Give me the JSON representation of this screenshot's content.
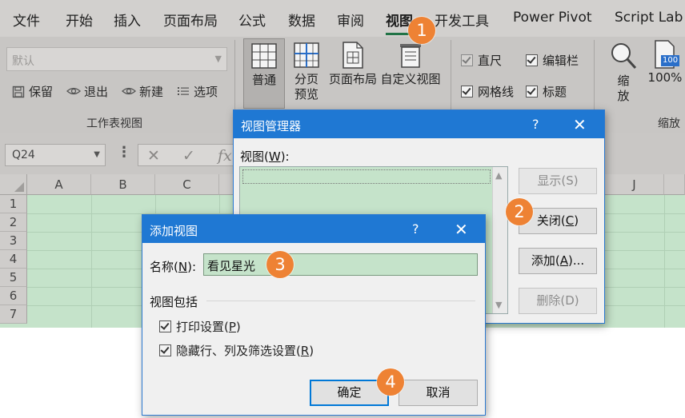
{
  "ribbon_tabs": [
    "文件",
    "开始",
    "插入",
    "页面布局",
    "公式",
    "数据",
    "审阅",
    "视图",
    "开发工具",
    "Power Pivot",
    "Script Lab"
  ],
  "active_tab": "视图",
  "workbook_views_group": {
    "sheet_view_combo": "默认",
    "keep_label": "保留",
    "exit_label": "退出",
    "new_label": "新建",
    "options_label": "选项",
    "group_label": "工作表视图"
  },
  "view_buttons": {
    "normal": "普通",
    "page_break_line1": "分页",
    "page_break_line2": "预览",
    "page_layout": "页面布局",
    "custom_views": "自定义视图"
  },
  "show_group": {
    "ruler": "直尺",
    "formula_bar": "编辑栏",
    "gridlines": "网格线",
    "headings": "标题"
  },
  "zoom_group": {
    "zoom_line1": "缩",
    "zoom_line2": "放",
    "zoom_100": "100%",
    "zoom_100_icon_text": "100",
    "group_label": "缩放"
  },
  "formula_bar": {
    "name_box": "Q24",
    "fx": "fx"
  },
  "grid": {
    "columns": [
      "A",
      "B",
      "C",
      "J"
    ],
    "rows": [
      "1",
      "2",
      "3",
      "4",
      "5",
      "6",
      "7"
    ]
  },
  "view_manager_dialog": {
    "title": "视图管理器",
    "help": "?",
    "views_label_prefix": "视图(",
    "views_label_key": "W",
    "views_label_suffix": "):",
    "show_button": "显示(S)",
    "close_button_prefix": "关闭(",
    "close_button_key": "C",
    "close_button_suffix": ")",
    "add_button_prefix": "添加(",
    "add_button_key": "A",
    "add_button_suffix": ")...",
    "delete_button": "删除(D)"
  },
  "add_view_dialog": {
    "title": "添加视图",
    "help": "?",
    "name_label_prefix": "名称(",
    "name_label_key": "N",
    "name_label_suffix": "):",
    "name_value": "看见星光",
    "include_label": "视图包括",
    "print_settings_prefix": "打印设置(",
    "print_settings_key": "P",
    "print_settings_suffix": ")",
    "hidden_settings_prefix": "隐藏行、列及筛选设置(",
    "hidden_settings_key": "R",
    "hidden_settings_suffix": ")",
    "ok_button": "确定",
    "cancel_button": "取消"
  },
  "step_badges": [
    "1",
    "2",
    "3",
    "4"
  ],
  "colors": {
    "title_bar": "#1f78d3",
    "badge": "#ee8234",
    "sheet_green": "#c5e3ca"
  }
}
